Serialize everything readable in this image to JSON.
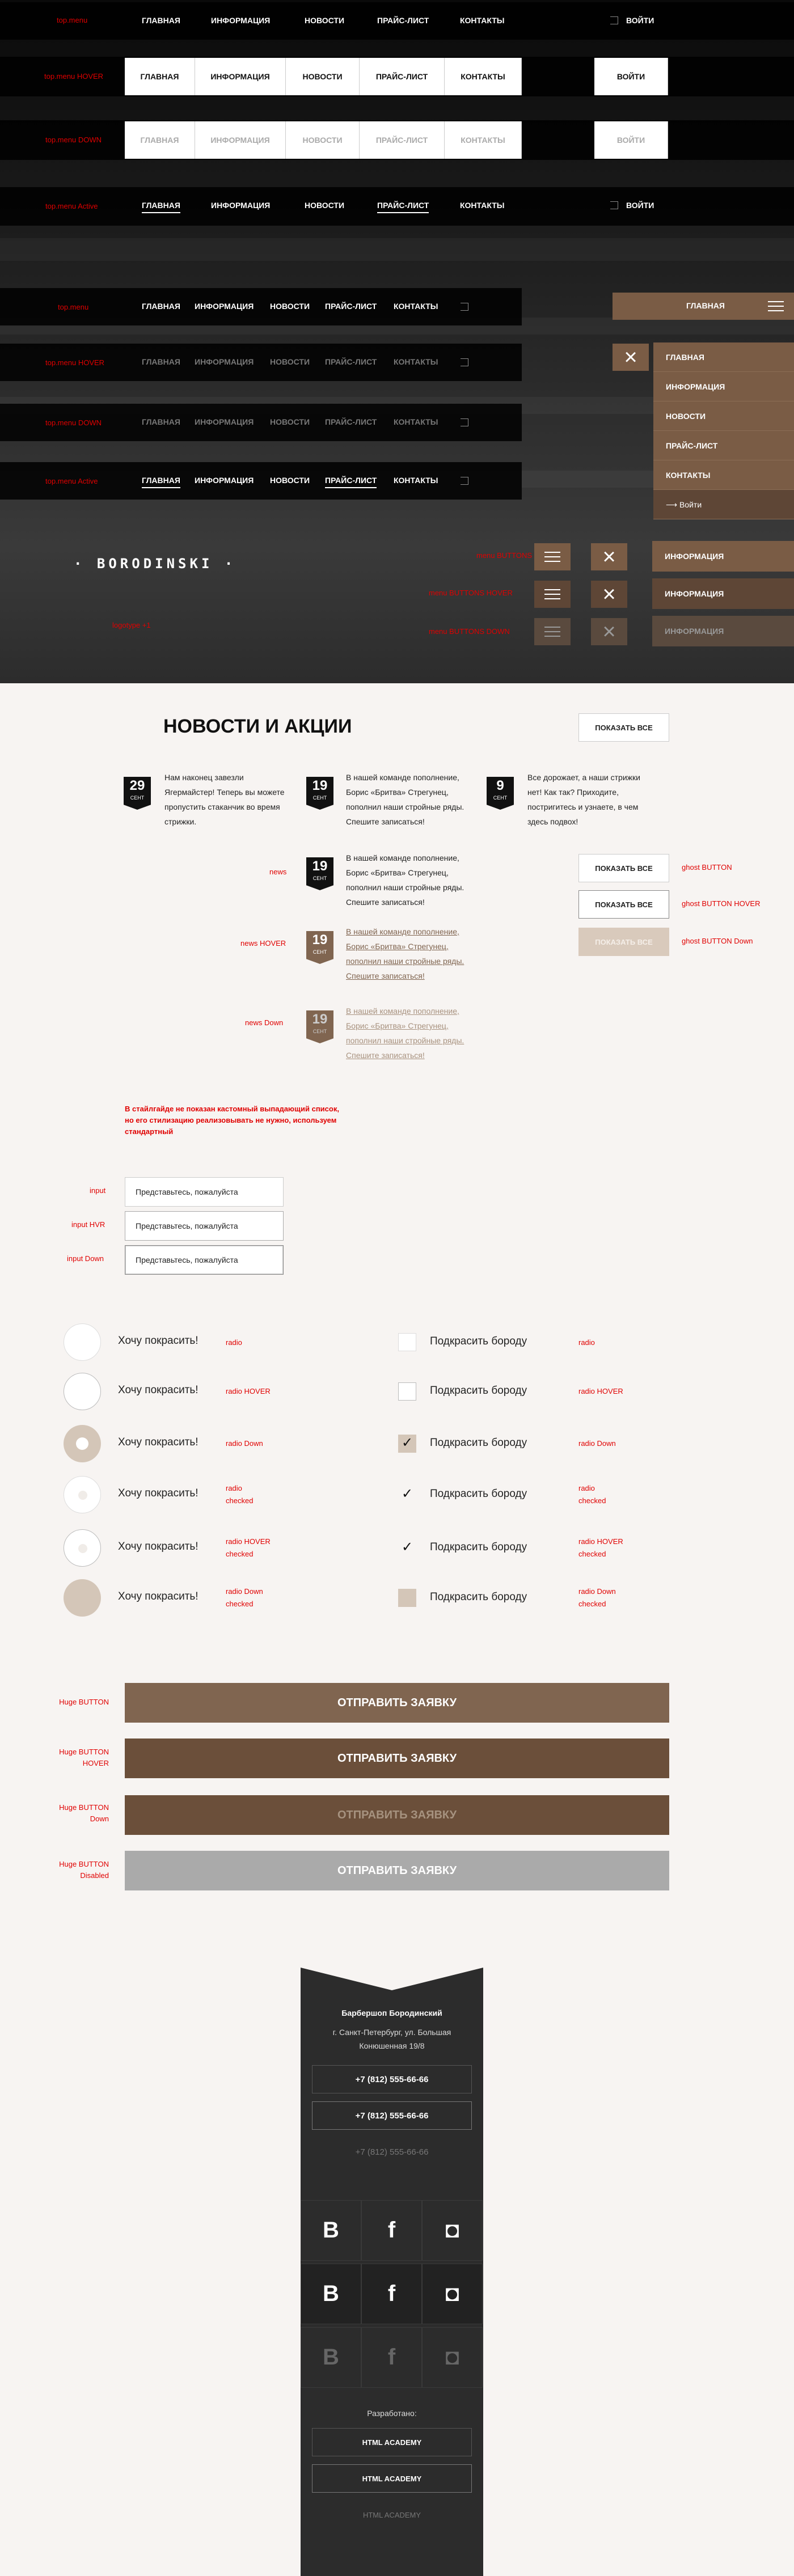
{
  "menu": [
    "ГЛАВНАЯ",
    "ИНФОРМАЦИЯ",
    "НОВОСТИ",
    "ПРАЙС-ЛИСТ",
    "КОНТАКТЫ"
  ],
  "login": "ВОЙТИ",
  "login_small": "Войти",
  "labels": {
    "top_menu": "top.menu",
    "top_menu_hover": "top.menu HOVER",
    "top_menu_down": "top.menu DOWN",
    "top_menu_active": "top.menu Active",
    "menu_buttons": "menu BUTTONS",
    "menu_buttons_hover": "menu BUTTONS HOVER",
    "menu_buttons_down": "menu BUTTONS DOWN",
    "logotype": "logotype +1",
    "news": "news",
    "news_hover": "news HOVER",
    "news_down": "news Down",
    "ghost": "ghost BUTTON",
    "ghost_hover": "ghost BUTTON HOVER",
    "ghost_down": "ghost BUTTON Down",
    "input": "input",
    "input_hvr": "input HVR",
    "input_down": "input Down",
    "radio": "radio",
    "radio_hover": "radio HOVER",
    "radio_down": "radio Down",
    "radio_checked": "radio\nchecked",
    "radio_hover_checked": "radio HOVER\nchecked",
    "radio_down_checked": "radio Down\nchecked",
    "huge": "Huge BUTTON",
    "huge_hover": "Huge BUTTON\nHOVER",
    "huge_down": "Huge BUTTON\nDown",
    "huge_disabled": "Huge BUTTON\nDisabled",
    "dropdown_note": "В стайлгайде не показан кастомный выпадающий список, но его стилизацию реализовывать не нужно, используем стандартный"
  },
  "logo": "· BORODINSKI ·",
  "news_title": "НОВОСТИ И АКЦИИ",
  "show_all": "ПОКАЗАТЬ ВСЕ",
  "news": [
    {
      "day": "29",
      "month": "СЕНТ",
      "text": "Нам наконец завезли Ягермайстер! Теперь вы можете пропустить стаканчик во время стрижки."
    },
    {
      "day": "19",
      "month": "СЕНТ",
      "text": "В нашей команде пополнение, Борис «Бритва» Стрегунец, пополнил наши стройные ряды. Спешите записаться!"
    },
    {
      "day": "9",
      "month": "СЕНТ",
      "text": "Все дорожает, а наши стрижки нет! Как так? Приходите, постригитесь и узнаете, в чем здесь подвох!"
    }
  ],
  "input_placeholder": "Представьтесь, пожалуйста",
  "radio_text": "Хочу покрасить!",
  "checkbox_text": "Подкрасить бороду",
  "submit": "ОТПРАВИТЬ ЗАЯВКУ",
  "footer": {
    "name": "Барбершоп Бородинский",
    "address1": "г. Санкт-Петербург, ул. Большая",
    "address2": "Конюшенная 19/8",
    "phone": "+7 (812) 555-66-66",
    "dev_label": "Разработано:",
    "dev": "HTML ACADEMY"
  },
  "colors": {
    "accent": "#806550",
    "accent_dark": "#6b4f3a",
    "accent_light": "#d4c6b8",
    "red": "#e00000"
  }
}
